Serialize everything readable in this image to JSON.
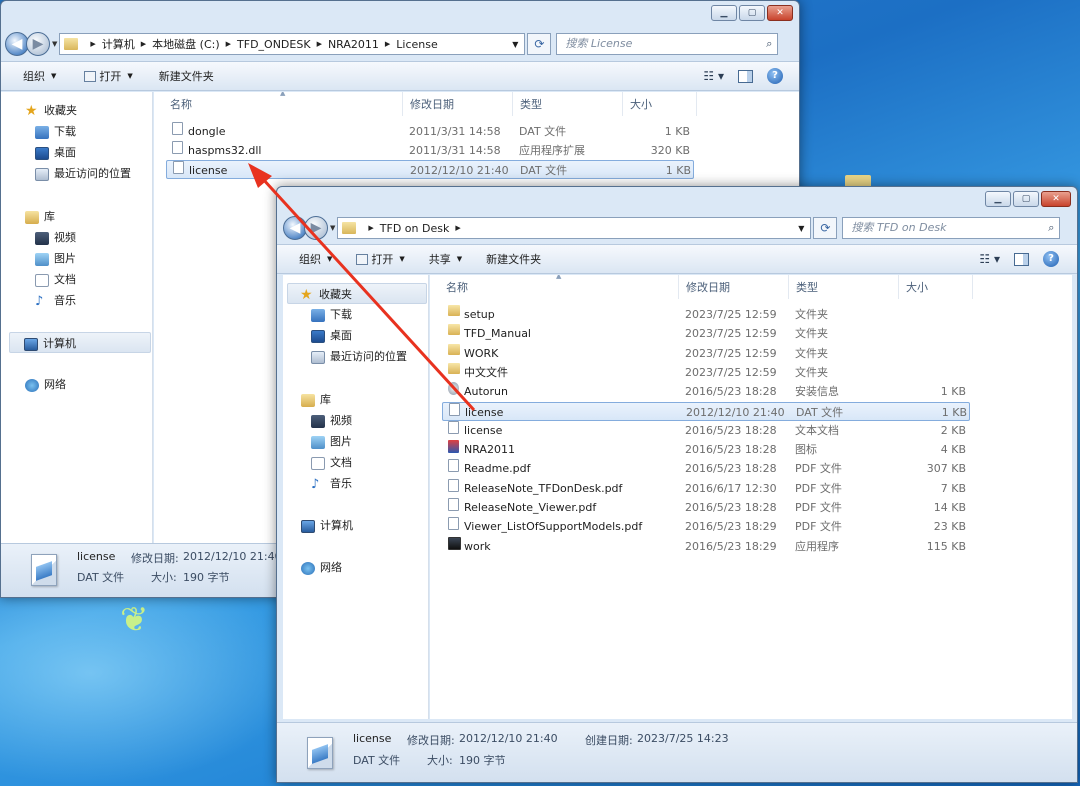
{
  "colors": {
    "accent": "#e8321f",
    "selection": "#d8e7f8",
    "desktop": "#2a7fd0"
  },
  "back_window": {
    "address": [
      "计算机",
      "本地磁盘 (C:)",
      "TFD_ONDESK",
      "NRA2011",
      "License"
    ],
    "search_placeholder": "搜索 License",
    "toolbar": {
      "organize": "组织",
      "open": "打开",
      "new_folder": "新建文件夹"
    },
    "columns": {
      "name": "名称",
      "date": "修改日期",
      "type": "类型",
      "size": "大小"
    },
    "nav": {
      "favorites": "收藏夹",
      "downloads": "下载",
      "desktop": "桌面",
      "recent": "最近访问的位置",
      "libraries": "库",
      "videos": "视频",
      "pictures": "图片",
      "documents": "文档",
      "music": "音乐",
      "computer": "计算机",
      "network": "网络"
    },
    "files": [
      {
        "name": "dongle",
        "date": "2011/3/31 14:58",
        "type": "DAT 文件",
        "size": "1 KB",
        "icon": "doc-icon"
      },
      {
        "name": "haspms32.dll",
        "date": "2011/3/31 14:58",
        "type": "应用程序扩展",
        "size": "320 KB",
        "icon": "dll-icon"
      },
      {
        "name": "license",
        "date": "2012/12/10 21:40",
        "type": "DAT 文件",
        "size": "1 KB",
        "icon": "doc-icon"
      }
    ],
    "status": {
      "name": "license",
      "date_label": "修改日期:",
      "date": "2012/12/10 21:40",
      "type": "DAT 文件",
      "size_label": "大小:",
      "size": "190 字节"
    }
  },
  "front_window": {
    "address": [
      "TFD on Desk"
    ],
    "search_placeholder": "搜索 TFD on Desk",
    "toolbar": {
      "organize": "组织",
      "open": "打开",
      "share": "共享",
      "new_folder": "新建文件夹"
    },
    "columns": {
      "name": "名称",
      "date": "修改日期",
      "type": "类型",
      "size": "大小"
    },
    "nav": {
      "favorites": "收藏夹",
      "downloads": "下载",
      "desktop": "桌面",
      "recent": "最近访问的位置",
      "libraries": "库",
      "videos": "视频",
      "pictures": "图片",
      "documents": "文档",
      "music": "音乐",
      "computer": "计算机",
      "network": "网络"
    },
    "files": [
      {
        "name": "setup",
        "date": "2023/7/25 12:59",
        "type": "文件夹",
        "size": "",
        "icon": "folder-icon"
      },
      {
        "name": "TFD_Manual",
        "date": "2023/7/25 12:59",
        "type": "文件夹",
        "size": "",
        "icon": "folder-icon"
      },
      {
        "name": "WORK",
        "date": "2023/7/25 12:59",
        "type": "文件夹",
        "size": "",
        "icon": "folder-icon"
      },
      {
        "name": "中文文件",
        "date": "2023/7/25 12:59",
        "type": "文件夹",
        "size": "",
        "icon": "folder-icon"
      },
      {
        "name": "Autorun",
        "date": "2016/5/23 18:28",
        "type": "安装信息",
        "size": "1 KB",
        "icon": "settings-file-icon"
      },
      {
        "name": "license",
        "date": "2012/12/10 21:40",
        "type": "DAT 文件",
        "size": "1 KB",
        "icon": "doc-icon"
      },
      {
        "name": "license",
        "date": "2016/5/23 18:28",
        "type": "文本文档",
        "size": "2 KB",
        "icon": "doc-icon"
      },
      {
        "name": "NRA2011",
        "date": "2016/5/23 18:28",
        "type": "图标",
        "size": "4 KB",
        "icon": "tfd-icon"
      },
      {
        "name": "Readme.pdf",
        "date": "2016/5/23 18:28",
        "type": "PDF 文件",
        "size": "307 KB",
        "icon": "pdf-icon"
      },
      {
        "name": "ReleaseNote_TFDonDesk.pdf",
        "date": "2016/6/17 12:30",
        "type": "PDF 文件",
        "size": "7 KB",
        "icon": "pdf-icon"
      },
      {
        "name": "ReleaseNote_Viewer.pdf",
        "date": "2016/5/23 18:28",
        "type": "PDF 文件",
        "size": "14 KB",
        "icon": "pdf-icon"
      },
      {
        "name": "Viewer_ListOfSupportModels.pdf",
        "date": "2016/5/23 18:29",
        "type": "PDF 文件",
        "size": "23 KB",
        "icon": "pdf-icon"
      },
      {
        "name": "work",
        "date": "2016/5/23 18:29",
        "type": "应用程序",
        "size": "115 KB",
        "icon": "app-icon"
      }
    ],
    "status": {
      "name": "license",
      "date_label": "修改日期:",
      "date": "2012/12/10 21:40",
      "created_label": "创建日期:",
      "created": "2023/7/25 14:23",
      "type": "DAT 文件",
      "size_label": "大小:",
      "size": "190 字节"
    }
  }
}
